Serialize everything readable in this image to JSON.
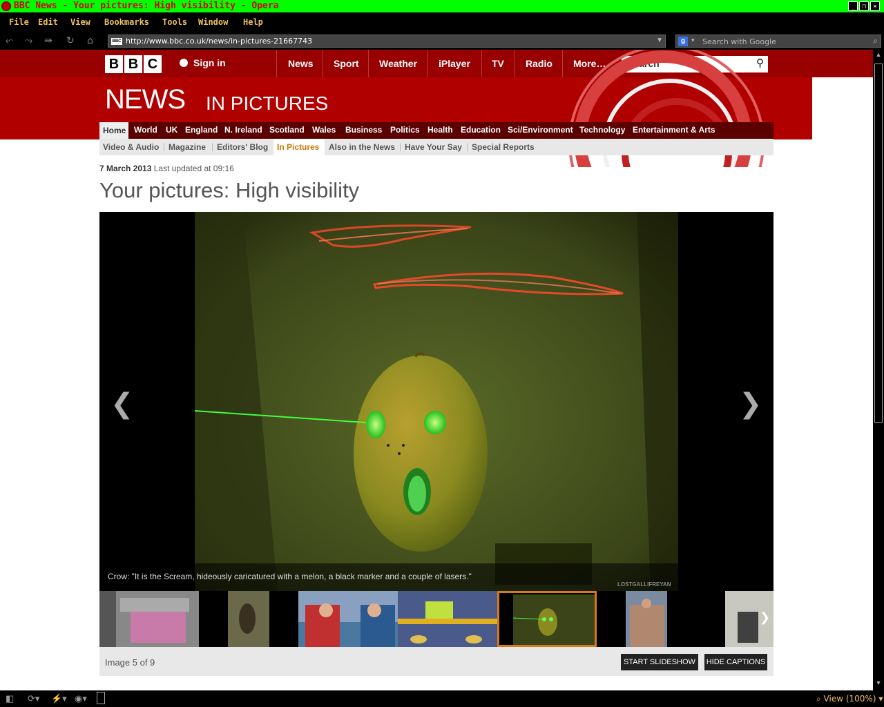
{
  "window": {
    "title": "BBC News - Your pictures: High visibility - Opera"
  },
  "menu": [
    "File",
    "Edit",
    "View",
    "Bookmarks",
    "Tools",
    "Window",
    "Help"
  ],
  "address": {
    "url": "http://www.bbc.co.uk/news/in-pictures-21667743",
    "search_placeholder": "Search with Google"
  },
  "bbc": {
    "logo_letters": [
      "B",
      "B",
      "C"
    ],
    "signin": "Sign in",
    "nav": [
      "News",
      "Sport",
      "Weather",
      "iPlayer",
      "TV",
      "Radio",
      "More…"
    ],
    "search_placeholder": "Search"
  },
  "banner": {
    "news": "NEWS",
    "section": "IN PICTURES"
  },
  "section_nav": [
    "Home",
    "World",
    "UK",
    "England",
    "N. Ireland",
    "Scotland",
    "Wales",
    "Business",
    "Politics",
    "Health",
    "Education",
    "Sci/Environment",
    "Technology",
    "Entertainment & Arts"
  ],
  "sub_nav": [
    "Video & Audio",
    "Magazine",
    "Editors' Blog",
    "In Pictures",
    "Also in the News",
    "Have Your Say",
    "Special Reports"
  ],
  "article": {
    "date": "7 March 2013",
    "updated": "Last updated at 09:16",
    "headline": "Your pictures: High visibility"
  },
  "gallery": {
    "caption": "Crow: \"It is the Scream, hideously caricatured with a melon, a black marker and a couple of lasers.\"",
    "credit": "LOSTGALLIFREYAN",
    "counter": "Image 5 of 9",
    "slideshow_button": "START SLIDESHOW",
    "captions_button": "HIDE CAPTIONS"
  },
  "status": {
    "zoom": "View (100%)"
  },
  "colors": {
    "titlebar": "#00ff00",
    "bbc_red": "#990000",
    "banner_red": "#b00000",
    "active_subnav": "#cc7700",
    "thumb_selected": "#d77a1a"
  }
}
